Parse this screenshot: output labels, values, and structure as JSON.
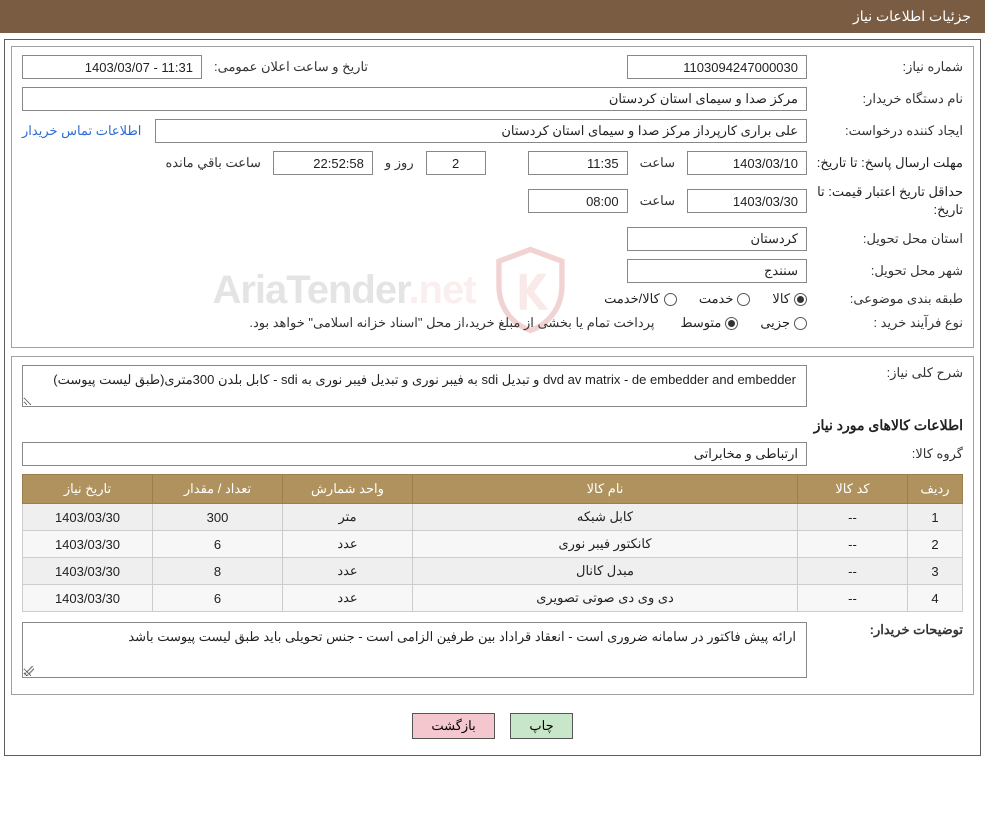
{
  "header": {
    "title": "جزئیات اطلاعات نیاز"
  },
  "info": {
    "req_no_label": "شماره نیاز:",
    "req_no": "1103094247000030",
    "announce_label": "تاریخ و ساعت اعلان عمومی:",
    "announce_value": "11:31 - 1403/03/07",
    "buyer_org_label": "نام دستگاه خریدار:",
    "buyer_org": "مرکز صدا و سیمای استان کردستان",
    "creator_label": "ایجاد کننده درخواست:",
    "creator": "علی براری کارپرداز مرکز صدا و سیمای استان کردستان",
    "contact_link": "اطلاعات تماس خریدار",
    "deadline_label": "مهلت ارسال پاسخ: تا تاریخ:",
    "deadline_date": "1403/03/10",
    "time_label": "ساعت",
    "deadline_time": "11:35",
    "days_remaining": "2",
    "days_and": "روز و",
    "time_remaining": "22:52:58",
    "remaining_suffix": "ساعت باقي مانده",
    "validity_label": "حداقل تاریخ اعتبار قیمت: تا تاریخ:",
    "validity_date": "1403/03/30",
    "validity_time": "08:00",
    "province_label": "استان محل تحویل:",
    "province": "کردستان",
    "city_label": "شهر محل تحویل:",
    "city": "سنندج",
    "category_label": "طبقه بندی موضوعی:",
    "cat_kala": "کالا",
    "cat_khedmat": "خدمت",
    "cat_kala_khedmat": "کالا/خدمت",
    "purchase_type_label": "نوع فرآیند خرید :",
    "pt_jozi": "جزیی",
    "pt_motevaset": "متوسط",
    "purchase_note": "پرداخت تمام یا بخشی از مبلغ خرید،از محل \"اسناد خزانه اسلامی\" خواهد بود."
  },
  "desc": {
    "overall_label": "شرح کلی نیاز:",
    "overall_text": "dvd av matrix - de embedder and embedder و تبدیل sdi به فیبر نوری و تبدیل فیبر نوری به sdi - کابل بلدن 300متری(طبق لیست پیوست)",
    "items_title": "اطلاعات کالاهای مورد نیاز",
    "group_label": "گروه کالا:",
    "group_value": "ارتباطی و مخابراتی"
  },
  "table": {
    "headers": {
      "row": "ردیف",
      "code": "کد کالا",
      "name": "نام کالا",
      "unit": "واحد شمارش",
      "qty": "تعداد / مقدار",
      "date": "تاریخ نیاز"
    },
    "rows": [
      {
        "row": "1",
        "code": "--",
        "name": "کابل شبکه",
        "unit": "متر",
        "qty": "300",
        "date": "1403/03/30"
      },
      {
        "row": "2",
        "code": "--",
        "name": "کانکتور فیبر نوری",
        "unit": "عدد",
        "qty": "6",
        "date": "1403/03/30"
      },
      {
        "row": "3",
        "code": "--",
        "name": "مبدل کانال",
        "unit": "عدد",
        "qty": "8",
        "date": "1403/03/30"
      },
      {
        "row": "4",
        "code": "--",
        "name": "دی وی دی صوتی تصویری",
        "unit": "عدد",
        "qty": "6",
        "date": "1403/03/30"
      }
    ]
  },
  "buyer_notes": {
    "label": "توضیحات خریدار:",
    "text": "ارائه پیش فاکتور در سامانه ضروری است - انعقاد قراداد بین طرفین الزامی است - جنس تحویلی باید طبق لیست پیوست باشد"
  },
  "buttons": {
    "print": "چاپ",
    "back": "بازگشت"
  },
  "watermark": {
    "text1": "AriaTender",
    "text2": ".net"
  }
}
